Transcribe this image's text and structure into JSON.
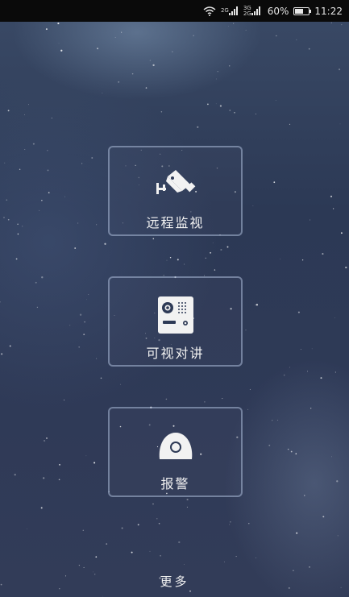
{
  "status_bar": {
    "network_top_1": "2G",
    "network_top_2": "3G",
    "network_bottom": "2G",
    "battery_text": "60%",
    "battery_level": 0.6,
    "time": "11:22"
  },
  "menu": {
    "items": [
      {
        "label": "远程监视",
        "icon": "security-camera-icon"
      },
      {
        "label": "可视对讲",
        "icon": "door-intercom-icon"
      },
      {
        "label": "报警",
        "icon": "alarm-siren-icon"
      }
    ],
    "more_label": "更多"
  }
}
